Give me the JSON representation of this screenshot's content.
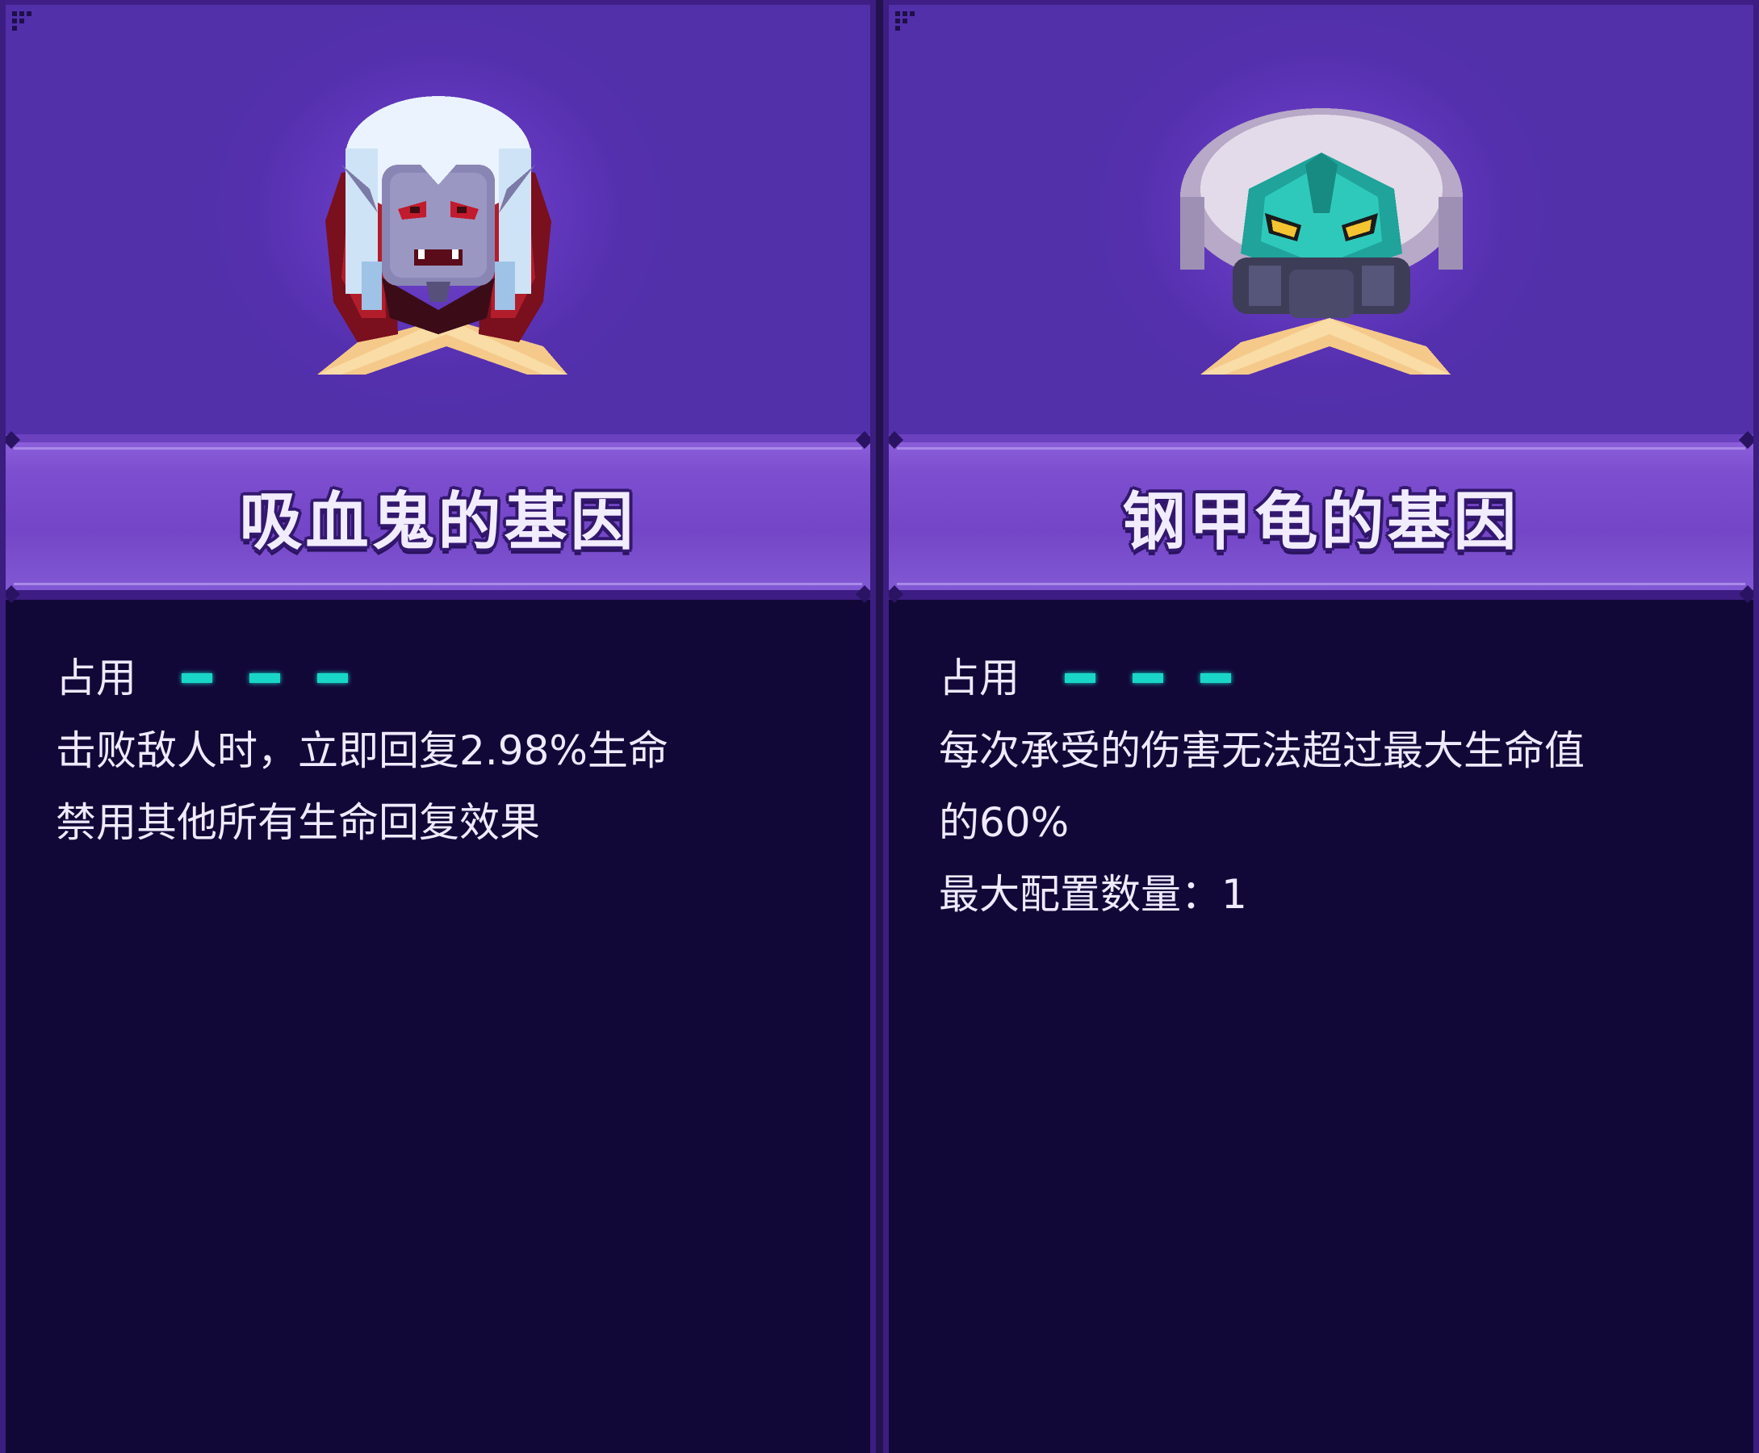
{
  "colors": {
    "frame": "#3c1d80",
    "portrait_bg": "#5a34b4",
    "title_band": "#7a4dcf",
    "body_bg": "#120838",
    "slot_pip": "#19d6c8",
    "text": "#efeaff"
  },
  "cards": [
    {
      "portrait_icon": "vampire-portrait-icon",
      "title": "吸血鬼的基因",
      "slots_label": "占用",
      "slots_count": 3,
      "lines": [
        "击败敌人时，立即回复2.98%生命",
        "禁用其他所有生命回复效果"
      ]
    },
    {
      "portrait_icon": "armored-turtle-portrait-icon",
      "title": "钢甲龟的基因",
      "slots_label": "占用",
      "slots_count": 3,
      "lines": [
        "每次承受的伤害无法超过最大生命值",
        "的60%",
        "最大配置数量：1"
      ]
    }
  ]
}
